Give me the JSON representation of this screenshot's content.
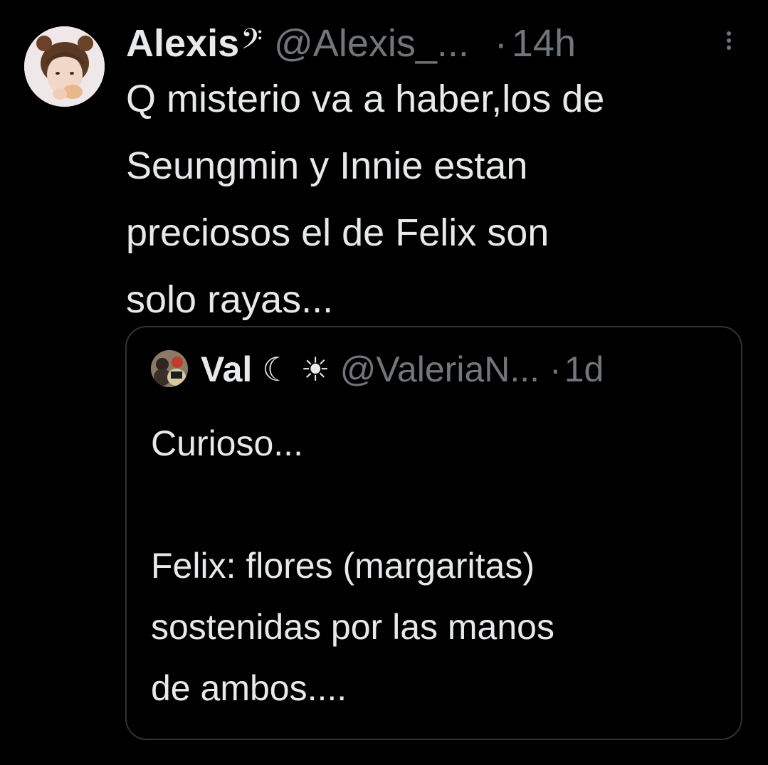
{
  "tweet": {
    "author": {
      "display_name": "Alexis",
      "name_decoration": "𝄢",
      "handle": "@Alexis_...",
      "avatar": "profile-avatar"
    },
    "separator": "·",
    "timestamp": "14h",
    "more_icon": "more-vertical-icon",
    "text": "Q misterio va a haber,los de\nSeungmin y Innie estan\npreciosos el de Felix son\nsolo rayas..."
  },
  "quoted_tweet": {
    "author": {
      "display_name": "Val",
      "name_decoration": "☾ ☀",
      "handle": "@ValeriaN...",
      "avatar": "quoted-profile-avatar"
    },
    "separator": "·",
    "timestamp": "1d",
    "text": "Curioso...\n\nFelix: flores (margaritas)\nsostenidas por las manos\nde ambos...."
  },
  "colors": {
    "background": "#000000",
    "primary_text": "#e7e9ea",
    "secondary_text": "#71767b",
    "border": "#2f3336"
  }
}
